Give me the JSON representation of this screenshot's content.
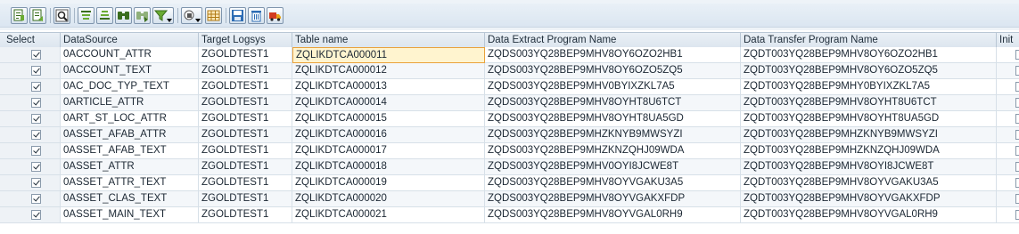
{
  "toolbar": {
    "buttons": [
      {
        "name": "details-icon"
      },
      {
        "name": "choose-icon"
      },
      {
        "name": "display-icon"
      },
      {
        "name": "sort-ascending-icon"
      },
      {
        "name": "sort-descending-icon"
      },
      {
        "name": "find-icon"
      },
      {
        "name": "find-next-icon"
      },
      {
        "name": "filter-icon",
        "dropdown": true
      },
      {
        "name": "layout-icon",
        "dropdown": true
      },
      {
        "name": "spreadsheet-icon"
      },
      {
        "name": "save-icon"
      },
      {
        "name": "delete-icon"
      },
      {
        "name": "transport-icon"
      }
    ]
  },
  "table": {
    "columns": [
      "Select",
      "DataSource",
      "Target Logsys",
      "Table name",
      "Data Extract Program Name",
      "Data Transfer Program Name",
      "Init"
    ],
    "active_cell": {
      "row": 0,
      "column": "table"
    },
    "rows": [
      {
        "selected": true,
        "datasource": "0ACCOUNT_ATTR",
        "logsys": "ZGOLDTEST1",
        "table": "ZQLIKDTCA000011",
        "extract": "ZQDS003YQ28BEP9MHV8OY6OZO2HB1",
        "transfer": "ZQDT003YQ28BEP9MHV8OY6OZO2HB1"
      },
      {
        "selected": true,
        "datasource": "0ACCOUNT_TEXT",
        "logsys": "ZGOLDTEST1",
        "table": "ZQLIKDTCA000012",
        "extract": "ZQDS003YQ28BEP9MHV8OY6OZO5ZQ5",
        "transfer": "ZQDT003YQ28BEP9MHV8OY6OZO5ZQ5"
      },
      {
        "selected": true,
        "datasource": "0AC_DOC_TYP_TEXT",
        "logsys": "ZGOLDTEST1",
        "table": "ZQLIKDTCA000013",
        "extract": "ZQDS003YQ28BEP9MHV0BYIXZKL7A5",
        "transfer": "ZQDT003YQ28BEP9MHY0BYIXZKL7A5"
      },
      {
        "selected": true,
        "datasource": "0ARTICLE_ATTR",
        "logsys": "ZGOLDTEST1",
        "table": "ZQLIKDTCA000014",
        "extract": "ZQDS003YQ28BEP9MHV8OYHT8U6TCT",
        "transfer": "ZQDT003YQ28BEP9MHV8OYHT8U6TCT"
      },
      {
        "selected": true,
        "datasource": "0ART_ST_LOC_ATTR",
        "logsys": "ZGOLDTEST1",
        "table": "ZQLIKDTCA000015",
        "extract": "ZQDS003YQ28BEP9MHV8OYHT8UA5GD",
        "transfer": "ZQDT003YQ28BEP9MHV8OYHT8UA5GD"
      },
      {
        "selected": true,
        "datasource": "0ASSET_AFAB_ATTR",
        "logsys": "ZGOLDTEST1",
        "table": "ZQLIKDTCA000016",
        "extract": "ZQDS003YQ28BEP9MHZKNYB9MWSYZI",
        "transfer": "ZQDT003YQ28BEP9MHZKNYB9MWSYZI"
      },
      {
        "selected": true,
        "datasource": "0ASSET_AFAB_TEXT",
        "logsys": "ZGOLDTEST1",
        "table": "ZQLIKDTCA000017",
        "extract": "ZQDS003YQ28BEP9MHZKNZQHJ09WDA",
        "transfer": "ZQDT003YQ28BEP9MHZKNZQHJ09WDA"
      },
      {
        "selected": true,
        "datasource": "0ASSET_ATTR",
        "logsys": "ZGOLDTEST1",
        "table": "ZQLIKDTCA000018",
        "extract": "ZQDS003YQ28BEP9MHV0OYI8JCWE8T",
        "transfer": "ZQDT003YQ28BEP9MHV8OYI8JCWE8T"
      },
      {
        "selected": true,
        "datasource": "0ASSET_ATTR_TEXT",
        "logsys": "ZGOLDTEST1",
        "table": "ZQLIKDTCA000019",
        "extract": "ZQDS003YQ28BEP9MHV8OYVGAKU3A5",
        "transfer": "ZQDT003YQ28BEP9MHV8OYVGAKU3A5"
      },
      {
        "selected": true,
        "datasource": "0ASSET_CLAS_TEXT",
        "logsys": "ZGOLDTEST1",
        "table": "ZQLIKDTCA000020",
        "extract": "ZQDS003YQ28BEP9MHV8OYVGAKXFDP",
        "transfer": "ZQDT003YQ28BEP9MHV8OYVGAKXFDP"
      },
      {
        "selected": true,
        "datasource": "0ASSET_MAIN_TEXT",
        "logsys": "ZGOLDTEST1",
        "table": "ZQLIKDTCA000021",
        "extract": "ZQDS003YQ28BEP9MHV8OYVGAL0RH9",
        "transfer": "ZQDT003YQ28BEP9MHV8OYVGAL0RH9"
      }
    ]
  }
}
